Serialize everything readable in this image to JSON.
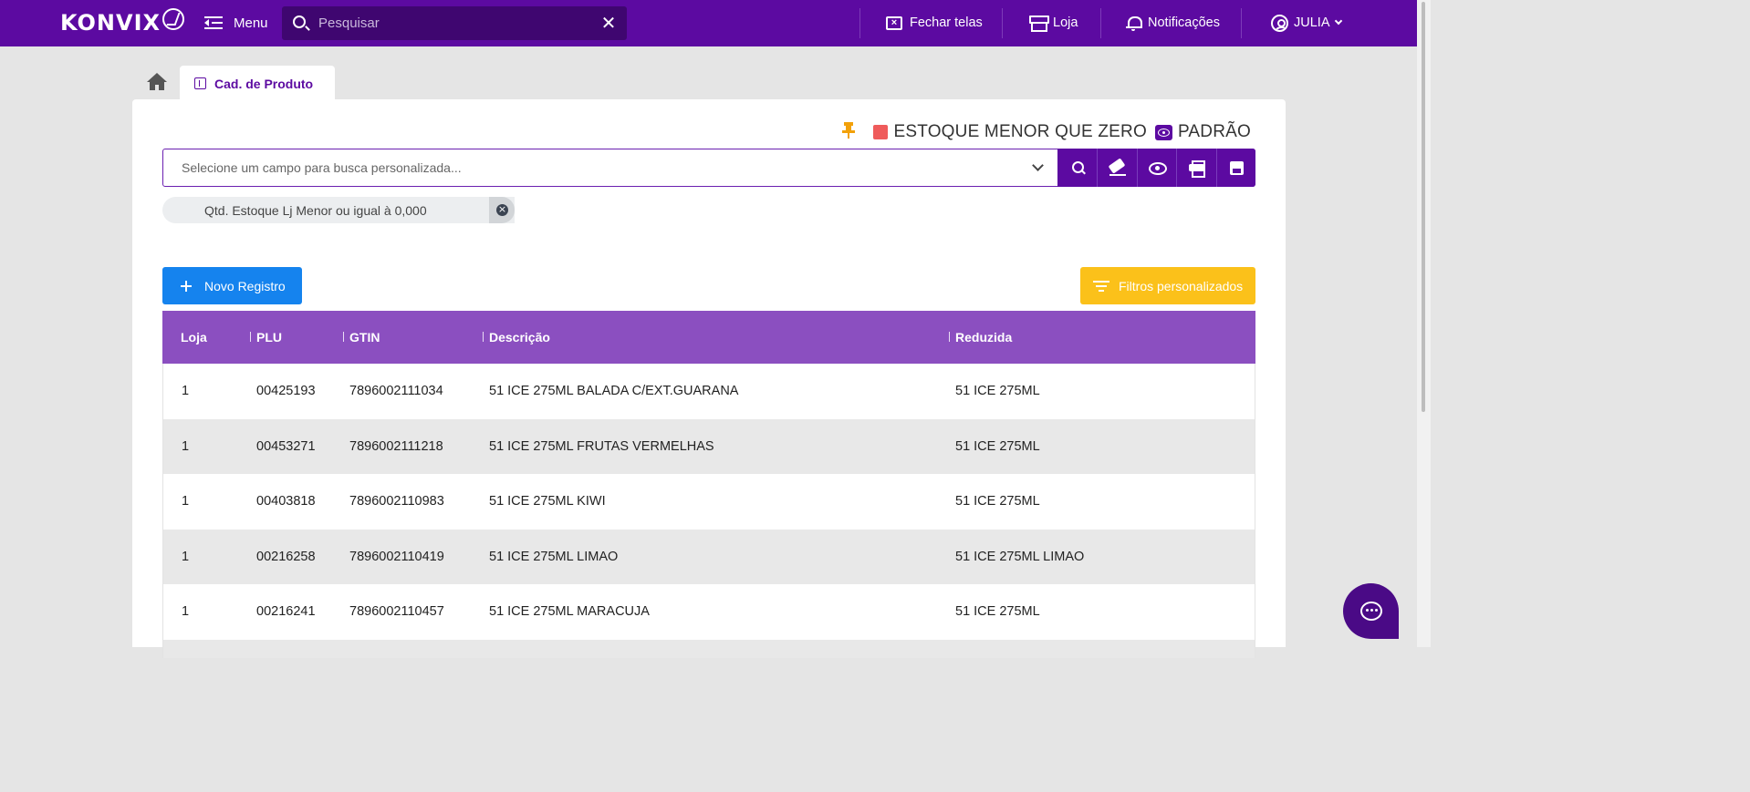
{
  "header": {
    "logo_text": "KONVIX",
    "menu_label": "Menu",
    "search_placeholder": "Pesquisar",
    "nav": {
      "close_screens": "Fechar telas",
      "store": "Loja",
      "notifications": "Notificações",
      "user": "JULIA"
    }
  },
  "tabs": {
    "active_label": "Cad. de Produto"
  },
  "status": {
    "filter_name": "ESTOQUE MENOR QUE ZERO",
    "view_name": "PADRÃO",
    "filter_color": "#ef5b5b"
  },
  "custom_search": {
    "placeholder": "Selecione um campo para busca personalizada..."
  },
  "filter_chip": {
    "label": "Qtd. Estoque Lj Menor ou igual à 0,000"
  },
  "buttons": {
    "new_record": "Novo Registro",
    "custom_filters": "Filtros personalizados"
  },
  "table": {
    "headers": [
      "Loja",
      "PLU",
      "GTIN",
      "Descrição",
      "Reduzida"
    ],
    "rows": [
      [
        "1",
        "00425193",
        "7896002111034",
        "51 ICE 275ML BALADA C/EXT.GUARANA",
        "51 ICE 275ML"
      ],
      [
        "1",
        "00453271",
        "7896002111218",
        "51 ICE 275ML FRUTAS VERMELHAS",
        "51 ICE 275ML"
      ],
      [
        "1",
        "00403818",
        "7896002110983",
        "51 ICE 275ML KIWI",
        "51 ICE 275ML"
      ],
      [
        "1",
        "00216258",
        "7896002110419",
        "51 ICE 275ML LIMAO",
        "51 ICE 275ML LIMAO"
      ],
      [
        "1",
        "00216241",
        "7896002110457",
        "51 ICE 275ML MARACUJA",
        "51 ICE 275ML"
      ]
    ]
  },
  "colors": {
    "brand_purple": "#5c0aa1",
    "table_header": "#8b4fc0",
    "primary_blue": "#1583ee",
    "warning_yellow": "#fbc11a"
  }
}
